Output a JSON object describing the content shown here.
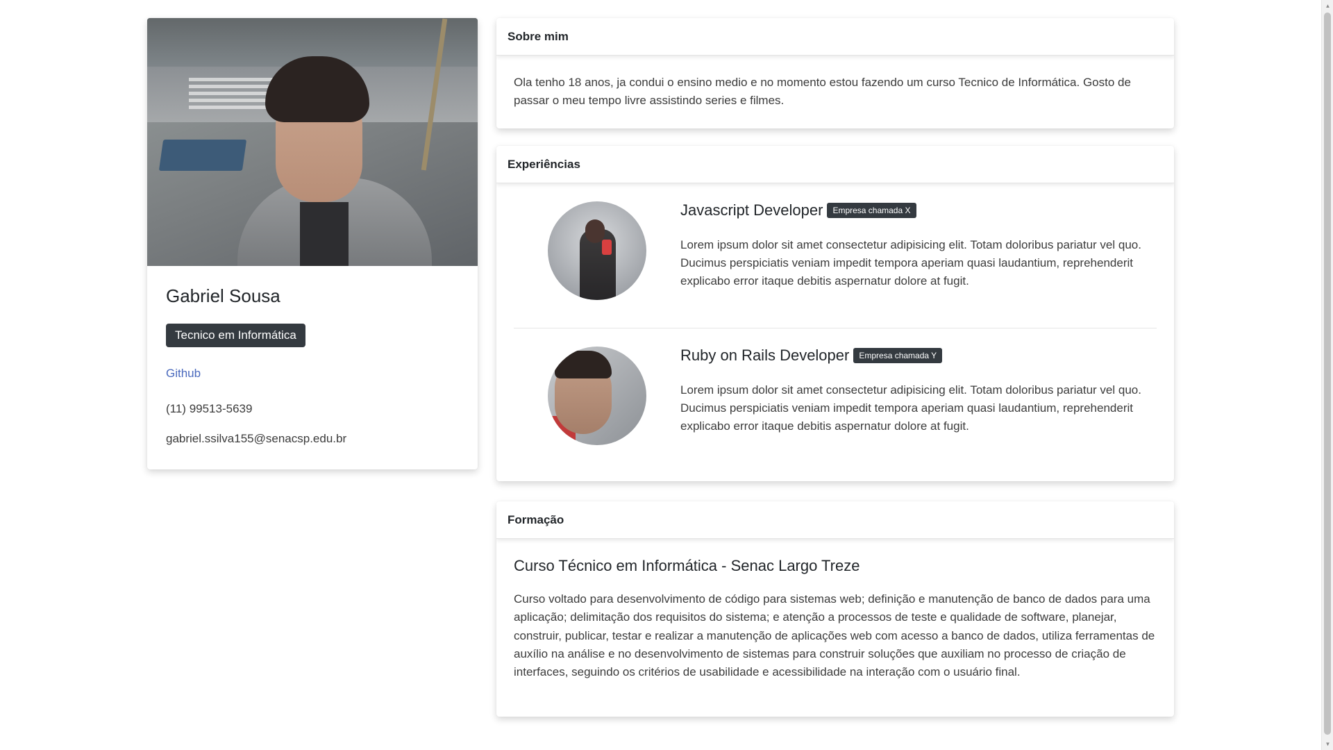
{
  "profile": {
    "name": "Gabriel Sousa",
    "badge": "Tecnico em Informática",
    "github_label": "Github",
    "phone": "(11) 99513-5639",
    "email": "gabriel.ssilva155@senacsp.edu.br"
  },
  "about": {
    "header": "Sobre mim",
    "text": "Ola tenho 18 anos, ja condui o ensino medio e no momento estou fazendo um curso Tecnico de Informática. Gosto de passar o meu tempo livre assistindo series e filmes."
  },
  "experiences": {
    "header": "Experiências",
    "items": [
      {
        "title": "Javascript Developer",
        "company": "Empresa chamada X",
        "description": "Lorem ipsum dolor sit amet consectetur adipisicing elit. Totam doloribus pariatur vel quo. Ducimus perspiciatis veniam impedit tempora aperiam quasi laudantium, reprehenderit explicabo error itaque debitis aspernatur dolore at fugit."
      },
      {
        "title": "Ruby on Rails Developer",
        "company": "Empresa chamada Y",
        "description": "Lorem ipsum dolor sit amet consectetur adipisicing elit. Totam doloribus pariatur vel quo. Ducimus perspiciatis veniam impedit tempora aperiam quasi laudantium, reprehenderit explicabo error itaque debitis aspernatur dolore at fugit."
      }
    ]
  },
  "education": {
    "header": "Formação",
    "title": "Curso Técnico em Informática - Senac Largo Treze",
    "description": "Curso voltado para desenvolvimento de código para sistemas web; definição e manutenção de banco de dados para uma aplicação; delimitação dos requisitos do sistema; e atenção a processos de teste e qualidade de software, planejar, construir, publicar, testar e realizar a manutenção de aplicações web com acesso a banco de dados, utiliza ferramentas de auxílio na análise e no desenvolvimento de sistemas para construir soluções que auxiliam no processo de criação de interfaces, seguindo os critérios de usabilidade e acessibilidade na interação com o usuário final."
  },
  "icons": {
    "scroll_up": "scroll-up-arrow-icon",
    "scroll_down": "scroll-down-arrow-icon"
  },
  "colors": {
    "badge_bg": "#343a40",
    "link": "#4a69bd"
  }
}
